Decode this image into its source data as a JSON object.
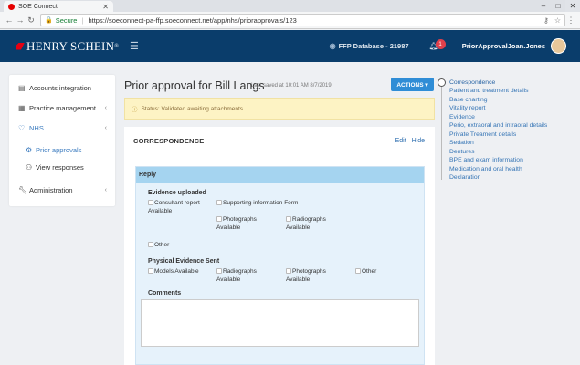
{
  "browser": {
    "tab_title": "SOE Connect",
    "secure_label": "Secure",
    "url": "https://soeconnect-pa-ffp.soeconnect.net/app/nhs/priorapprovals/123"
  },
  "header": {
    "brand": "HENRY SCHEIN",
    "brand_mark": "®",
    "database": "FFP Database - 21987",
    "notification_count": "1",
    "user": "PriorApprovalJoan.Jones"
  },
  "sidebar": {
    "items": [
      {
        "label": "Accounts integration",
        "icon": "list-icon"
      },
      {
        "label": "Practice management",
        "icon": "calendar-icon"
      },
      {
        "label": "NHS",
        "icon": "heart-icon"
      },
      {
        "label": "Prior approvals",
        "icon": "gear-icon"
      },
      {
        "label": "View responses",
        "icon": "people-icon"
      },
      {
        "label": "Administration",
        "icon": "wrench-icon"
      }
    ]
  },
  "main": {
    "title": "Prior approval for Bill Langs",
    "last_saved": "Last saved at 10:01 AM 8/7/2019",
    "actions_label": "ACTIONS ▾",
    "status": "Status: Validated awaiting attachments",
    "card_title": "CORRESPONDENCE",
    "edit_label": "Edit",
    "hide_label": "Hide",
    "reply_title": "Reply",
    "evidence_heading": "Evidence uploaded",
    "evidence_options": [
      "Consultant report Available",
      "Supporting information Form",
      "Photographs Available",
      "Radiographs Available",
      "Other"
    ],
    "physical_heading": "Physical Evidence Sent",
    "physical_options": [
      "Models Available",
      "Radiographs Available",
      "Photographs Available",
      "Other"
    ],
    "comments_label": "Comments"
  },
  "toc": {
    "items": [
      "Correspondence",
      "Patient and treatment details",
      "Base charting",
      "Vitality report",
      "Evidence",
      "Perio, extraoral and intraoral details",
      "Private Treament details",
      "Sedation",
      "Dentures",
      "BPE and exam information",
      "Medication and oral health",
      "Declaration"
    ]
  },
  "colors": {
    "header_bg": "#0a3d6b",
    "accent": "#2f8dd6",
    "status_bg": "#fdf3c4",
    "reply_header": "#a5d4f0"
  }
}
